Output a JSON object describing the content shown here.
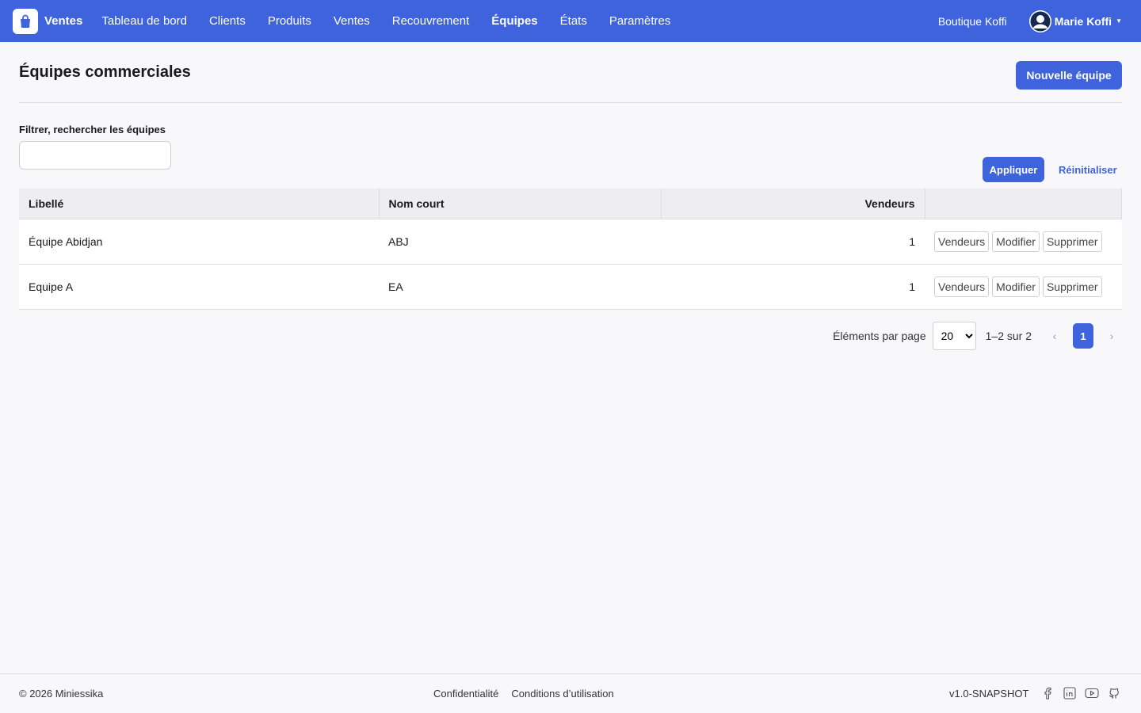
{
  "app": {
    "name": "Ventes"
  },
  "nav": {
    "items": [
      {
        "label": "Tableau de bord"
      },
      {
        "label": "Clients"
      },
      {
        "label": "Produits"
      },
      {
        "label": "Ventes"
      },
      {
        "label": "Recouvrement"
      },
      {
        "label": "Équipes",
        "active": true
      },
      {
        "label": "États"
      },
      {
        "label": "Paramètres"
      }
    ]
  },
  "header": {
    "shop": "Boutique Koffi",
    "user": "Marie Koffi"
  },
  "page": {
    "title": "Équipes commerciales",
    "new_button": "Nouvelle équipe"
  },
  "filter": {
    "label": "Filtrer, rechercher les équipes",
    "value": "",
    "apply": "Appliquer",
    "reset": "Réinitialiser"
  },
  "table": {
    "columns": [
      "Libellé",
      "Nom court",
      "Vendeurs"
    ],
    "rows": [
      {
        "label": "Équipe Abidjan",
        "short": "ABJ",
        "sellers": "1"
      },
      {
        "label": "Equipe A",
        "short": "EA",
        "sellers": "1"
      }
    ],
    "actions": {
      "sellers": "Vendeurs",
      "edit": "Modifier",
      "delete": "Supprimer"
    }
  },
  "pagination": {
    "per_page_label": "Éléments par page",
    "per_page": "20",
    "range": "1–2 sur 2",
    "current": "1",
    "prev": "‹",
    "next": "›"
  },
  "footer": {
    "copyright": "© 2026 Miniessika",
    "links": [
      "Confidentialité",
      "Conditions d’utilisation"
    ],
    "version": "v1.0-SNAPSHOT"
  },
  "colors": {
    "primary": "#3f63dc"
  }
}
